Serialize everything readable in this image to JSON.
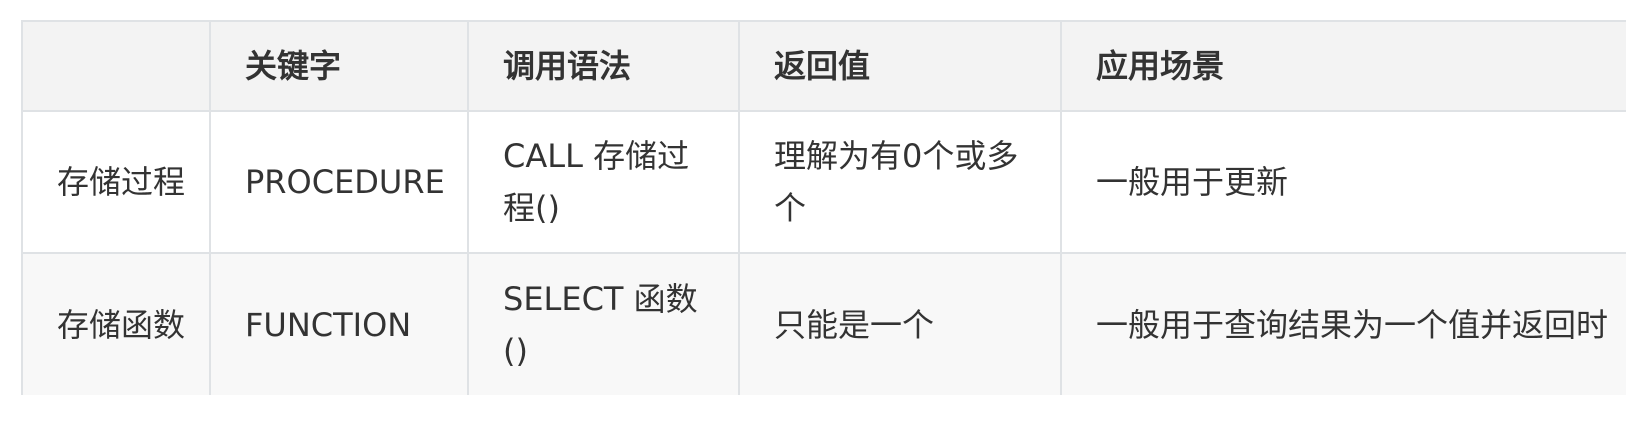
{
  "table": {
    "headers": [
      "",
      "关键字",
      "调用语法",
      "返回值",
      "应用场景"
    ],
    "rows": [
      {
        "name": "存储过程",
        "keyword": "PROCEDURE",
        "syntax": "CALL 存储过程()",
        "returns": "理解为有0个或多个",
        "usage": "一般用于更新"
      },
      {
        "name": "存储函数",
        "keyword": "FUNCTION",
        "syntax": "SELECT 函数 ()",
        "returns": "只能是一个",
        "usage": "一般用于查询结果为一个值并返回时"
      }
    ]
  }
}
